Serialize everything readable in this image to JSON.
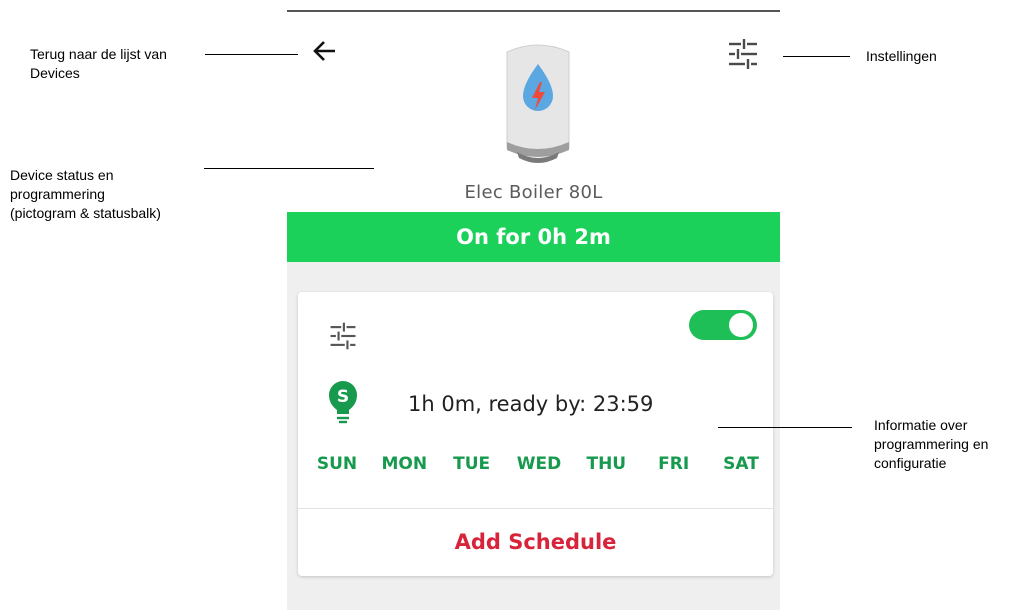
{
  "device": {
    "name": "Elec Boiler 80L",
    "status": "On for 0h 2m"
  },
  "schedule": {
    "info": "1h 0m, ready by: 23:59",
    "enabled": true,
    "days": [
      "SUN",
      "MON",
      "TUE",
      "WED",
      "THU",
      "FRI",
      "SAT"
    ],
    "add_label": "Add Schedule"
  },
  "annotations": {
    "back": [
      "Terug naar de lijst van",
      "Devices"
    ],
    "status": [
      "Device status en",
      "programmering",
      "(pictogram & statusbalk)"
    ],
    "settings": "Instellingen",
    "schedule": [
      "Informatie over",
      "programmering en",
      "configuratie"
    ]
  },
  "icons": {
    "back": "arrow-left-icon",
    "settings": "sliders-icon",
    "boiler": "boiler-icon",
    "schedule_type": "bulb-s-icon"
  },
  "colors": {
    "status_green": "#1bd15a",
    "day_green": "#179a4e",
    "add_red": "#d7243a",
    "toggle_green": "#1fbf57"
  }
}
